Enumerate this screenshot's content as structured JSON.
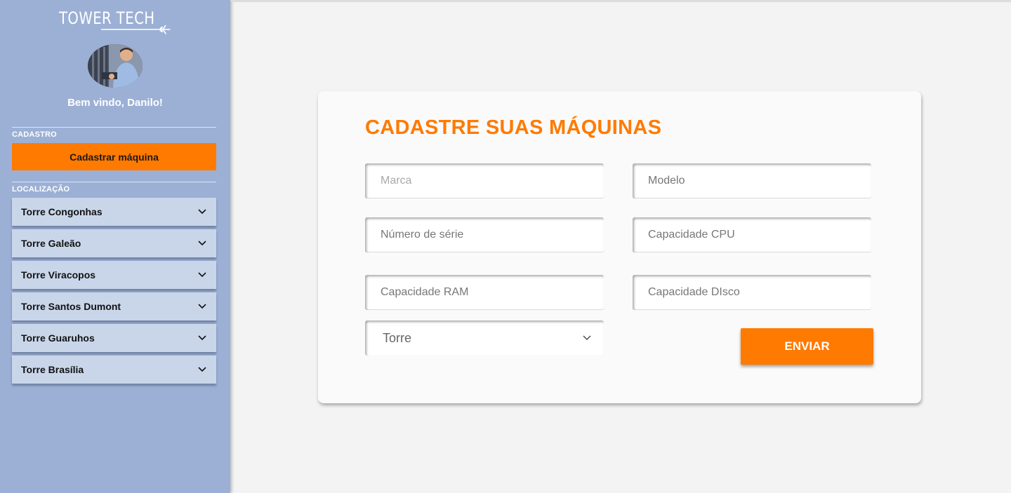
{
  "brand": {
    "logo_text": "TOWER TECH"
  },
  "sidebar": {
    "welcome": "Bem vindo, Danilo!",
    "cadastro_label": "CADASTRO",
    "cadastro_button": "Cadastrar máquina",
    "localizacao_label": "LOCALIZAÇÃO",
    "locations": [
      {
        "label": "Torre Congonhas"
      },
      {
        "label": "Torre Galeão"
      },
      {
        "label": "Torre Viracopos"
      },
      {
        "label": "Torre Santos Dumont"
      },
      {
        "label": "Torre Guaruhos"
      },
      {
        "label": "Torre Brasília"
      }
    ]
  },
  "form": {
    "title": "CADASTRE SUAS MÁQUINAS",
    "fields": {
      "marca": {
        "placeholder": "Marca",
        "value": ""
      },
      "modelo": {
        "placeholder": "Modelo",
        "value": ""
      },
      "numero_serie": {
        "placeholder": "Número de série",
        "value": ""
      },
      "capacidade_cpu": {
        "placeholder": "Capacidade CPU",
        "value": ""
      },
      "capacidade_ram": {
        "placeholder": "Capacidade RAM",
        "value": ""
      },
      "capacidade_disco": {
        "placeholder": "Capacidade DIsco",
        "value": ""
      }
    },
    "torre_select": {
      "selected": "Torre"
    },
    "submit_label": "ENVIAR"
  },
  "colors": {
    "accent": "#ff7a00",
    "sidebar_bg": "#9cb0d5",
    "sidebar_item_bg": "#c9d6ea",
    "page_bg": "#f3f3f3",
    "card_bg": "#fafafa"
  },
  "icons": {
    "logo": "airplane-icon",
    "location_expand": "chevron-down-icon",
    "select_expand": "chevron-down-icon"
  }
}
